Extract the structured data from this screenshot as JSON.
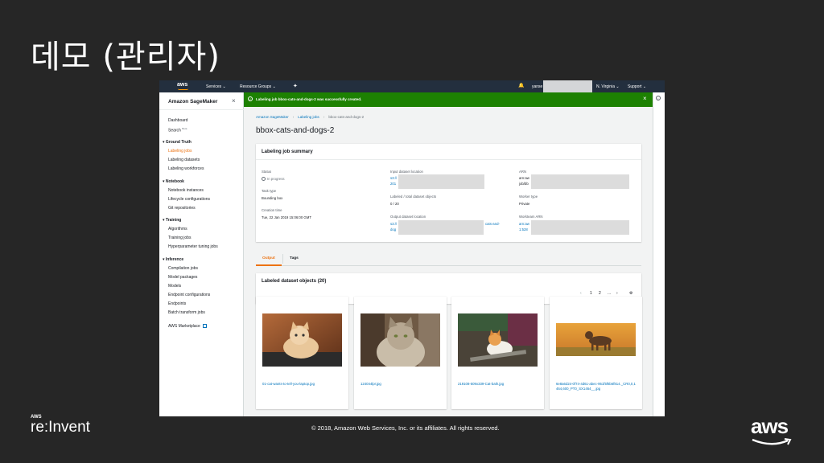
{
  "slide": {
    "title": "데모 (관리자)",
    "copyright": "© 2018, Amazon Web Services, Inc. or its affiliates. All rights reserved.",
    "footer_brand_small": "AWS",
    "footer_brand_big": "re:Invent",
    "aws_logo": "aws"
  },
  "topnav": {
    "logo": "aws",
    "services": "Services ⌄",
    "resource_groups": "Resource Groups ⌄",
    "user": "yanse",
    "region": "N. Virginia ⌄",
    "support": "Support ⌄",
    "icons": [
      "pin-icon",
      "bell-icon"
    ]
  },
  "sidebar": {
    "title": "Amazon SageMaker",
    "items": [
      {
        "label": "Dashboard",
        "type": "item"
      },
      {
        "label": "Search",
        "badge": "Beta",
        "type": "item"
      },
      {
        "label": "Ground Truth",
        "type": "group"
      },
      {
        "label": "Labeling jobs",
        "type": "item",
        "active": true
      },
      {
        "label": "Labeling datasets",
        "type": "item"
      },
      {
        "label": "Labeling workforces",
        "type": "item"
      },
      {
        "label": "Notebook",
        "type": "group"
      },
      {
        "label": "Notebook instances",
        "type": "item"
      },
      {
        "label": "Lifecycle configurations",
        "type": "item"
      },
      {
        "label": "Git repositories",
        "type": "item"
      },
      {
        "label": "Training",
        "type": "group"
      },
      {
        "label": "Algorithms",
        "type": "item"
      },
      {
        "label": "Training jobs",
        "type": "item"
      },
      {
        "label": "Hyperparameter tuning jobs",
        "type": "item"
      },
      {
        "label": "Inference",
        "type": "group"
      },
      {
        "label": "Compilation jobs",
        "type": "item"
      },
      {
        "label": "Model packages",
        "type": "item"
      },
      {
        "label": "Models",
        "type": "item"
      },
      {
        "label": "Endpoint configurations",
        "type": "item"
      },
      {
        "label": "Endpoints",
        "type": "item"
      },
      {
        "label": "Batch transform jobs",
        "type": "item"
      },
      {
        "label": "AWS Marketplace",
        "type": "item",
        "external": true
      }
    ]
  },
  "flash": {
    "message": "Labeling job bbox-cats-and-dogs-2 was successfully created.",
    "color": "#1d8102"
  },
  "breadcrumb": [
    "Amazon SageMaker",
    "Labeling jobs",
    "bbox-cats-and-dogs-2"
  ],
  "page_title": "bbox-cats-and-dogs-2",
  "summary": {
    "title": "Labeling job summary",
    "status_label": "Status",
    "status_value": "In progress",
    "task_type_label": "Task type",
    "task_type_value": "Bounding box",
    "creation_time_label": "Creation time",
    "creation_time_value": "Tue, 22 Jan 2019 15:06:00 GMT",
    "input_label": "Input dataset location",
    "input_value_a": "s3://",
    "input_value_b": "201",
    "labeled_label": "Labeled / total dataset objects",
    "labeled_value": "0 / 20",
    "output_label": "Output dataset location",
    "output_value_a": "s3://",
    "output_value_b": "dog",
    "output_value_c": "cats-and-",
    "arn_label": "ARN",
    "arn_value_a": "arn:aw",
    "arn_value_b": "job/bb",
    "worker_label": "Worker type",
    "worker_value": "Private",
    "workteam_label": "Workteam ARN",
    "workteam_value_a": "arn:aw",
    "workteam_value_b": "1:528"
  },
  "tabs": [
    {
      "label": "Output",
      "active": true
    },
    {
      "label": "Tags",
      "active": false
    }
  ],
  "objects": {
    "title": "Labeled dataset objects",
    "count": "(20)",
    "pager": {
      "prev": "‹",
      "page1": "1",
      "page2": "2",
      "ellipsis": "...",
      "next": "›",
      "settings": "⚙"
    }
  },
  "cards": [
    {
      "file": "01-cat-wants-to-tell-you-laptop.jpg"
    },
    {
      "file": "124044lpr.jpg"
    },
    {
      "file": "219108-509x339-Cat-bath.jpg"
    },
    {
      "file": "6e8a6d24-0f74-4d61-abec-951f5f6b6f814._CR0,0,1464,600_PT0_SX1464__.jpg"
    }
  ]
}
